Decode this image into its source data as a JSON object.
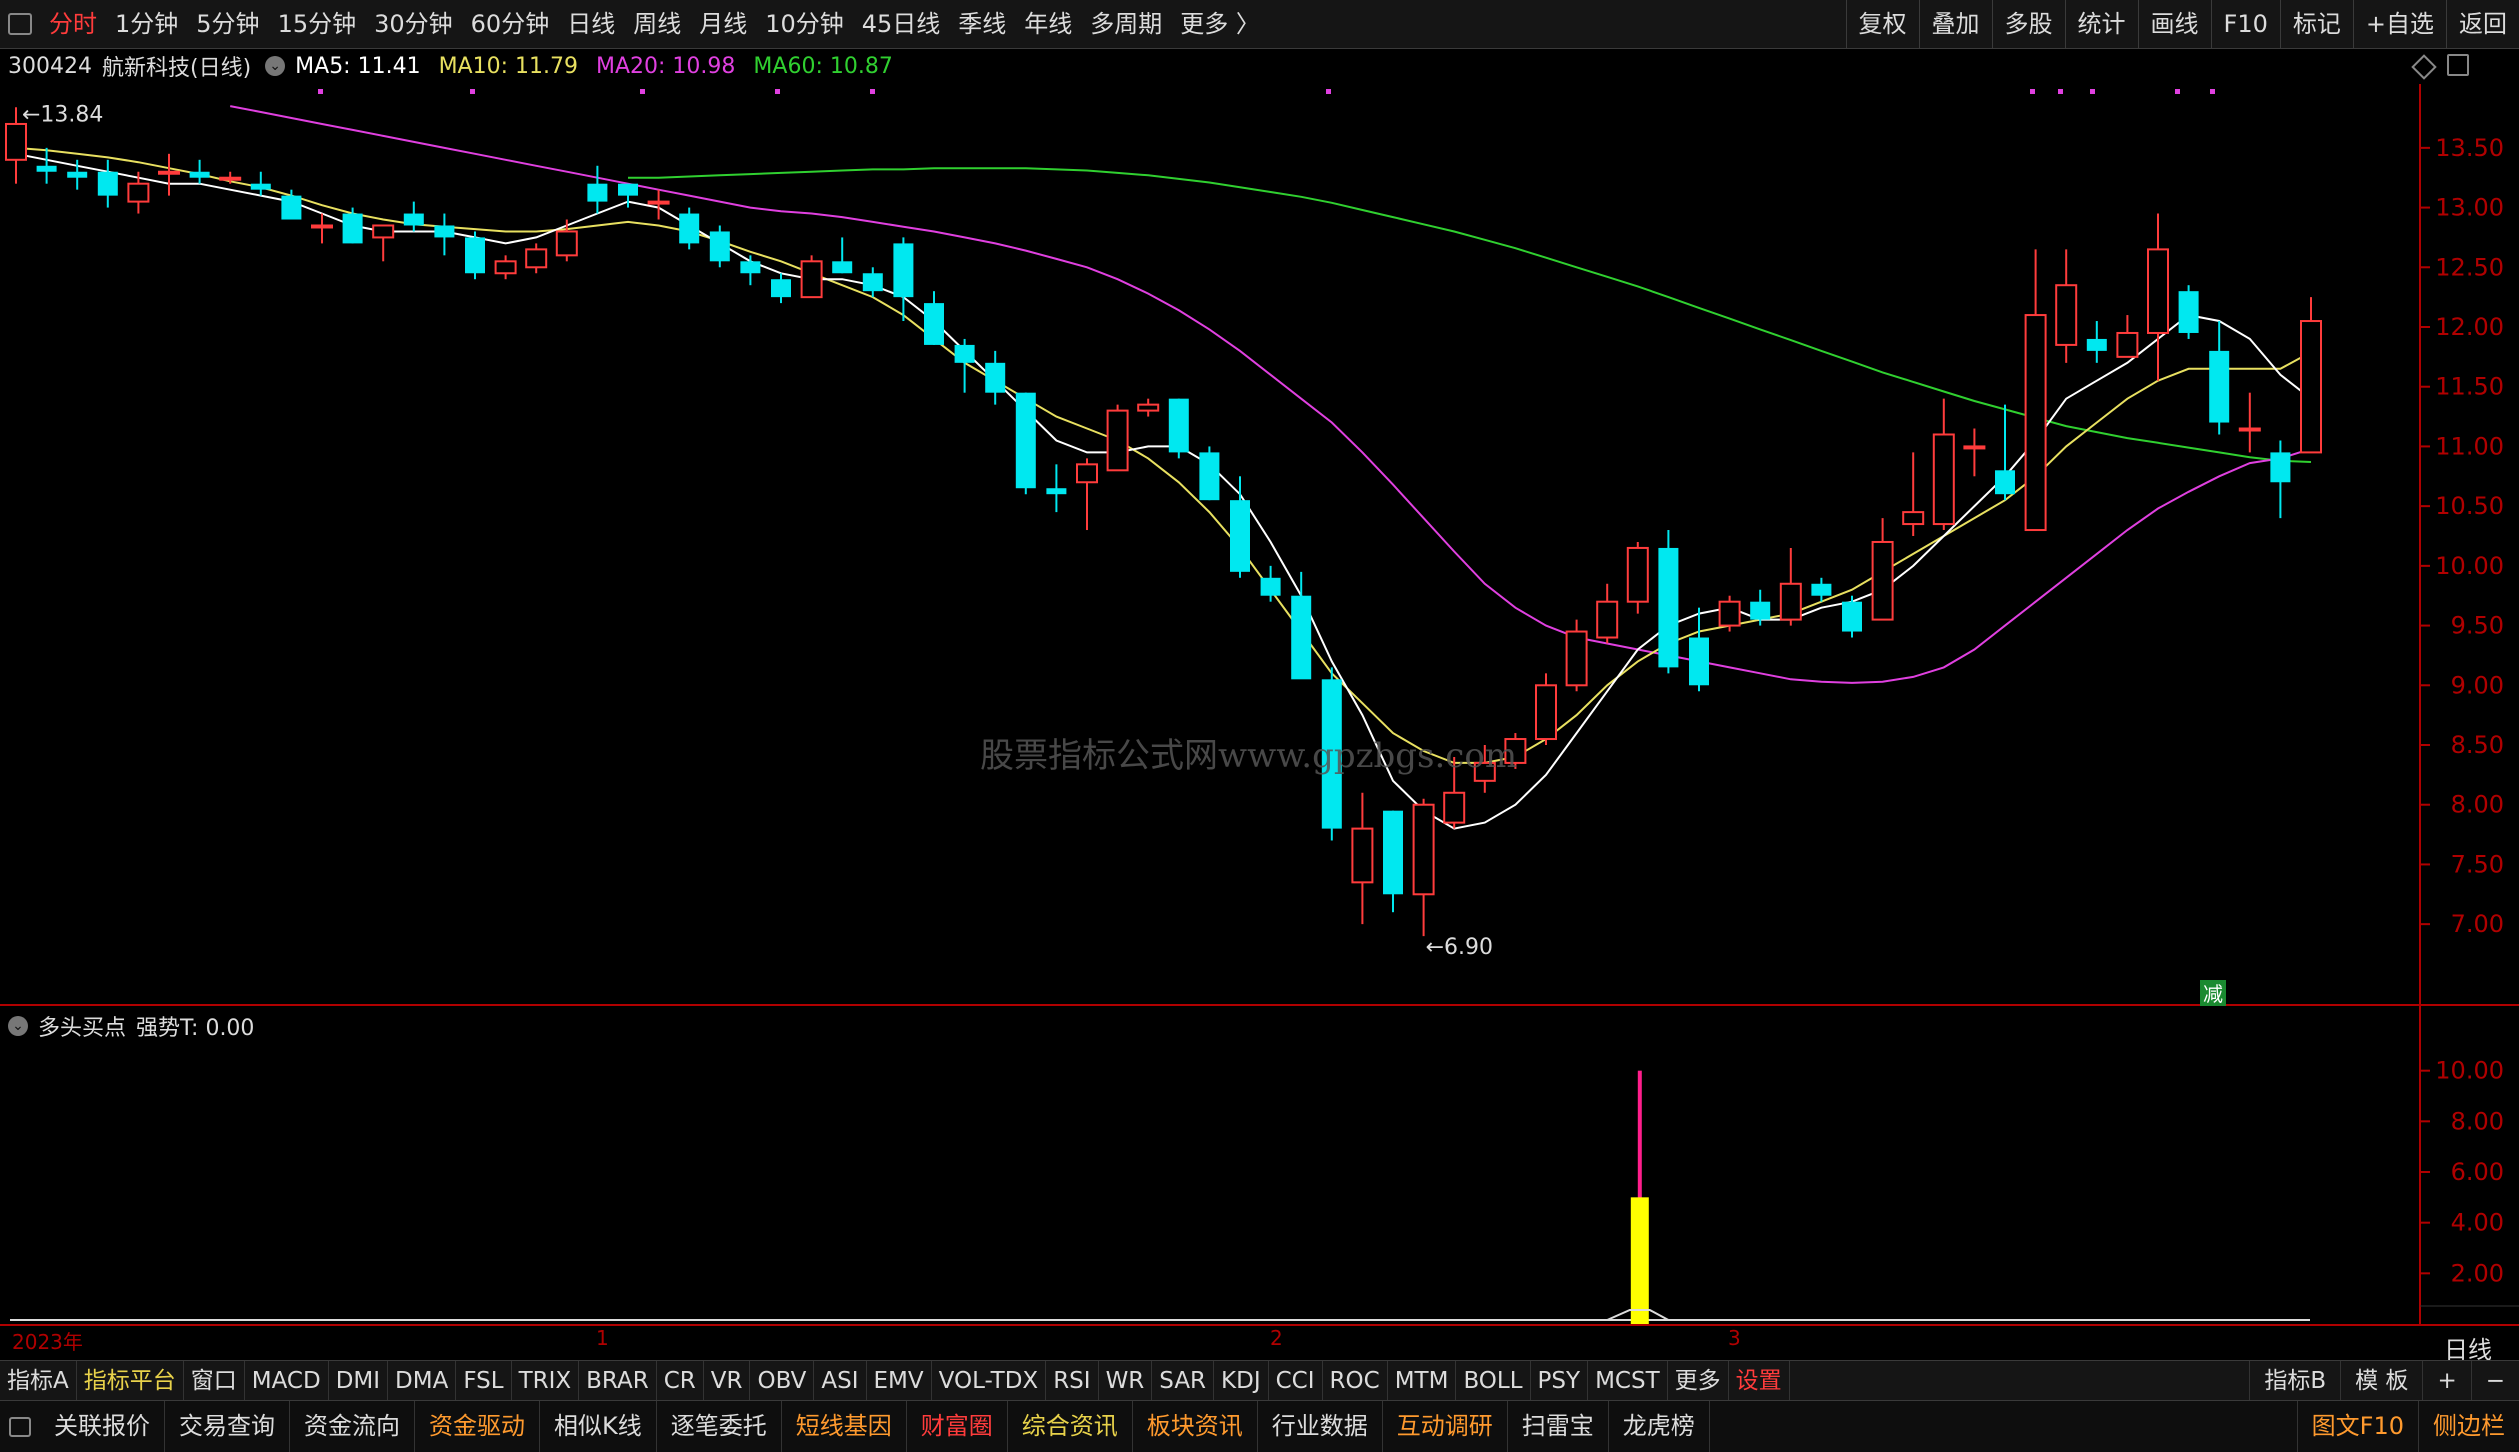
{
  "topbar": {
    "periods": [
      "分时",
      "1分钟",
      "5分钟",
      "15分钟",
      "30分钟",
      "60分钟",
      "日线",
      "周线",
      "月线",
      "10分钟",
      "45日线",
      "季线",
      "年线",
      "多周期",
      "更多 〉"
    ],
    "active_period": "分时",
    "tools": [
      "复权",
      "叠加",
      "多股",
      "统计",
      "画线",
      "F10",
      "标记",
      "+自选",
      "返回"
    ]
  },
  "stock": {
    "code": "300424",
    "name": "航新科技(日线)",
    "ma5_label": "MA5: 11.41",
    "ma10_label": "MA10: 11.79",
    "ma20_label": "MA20: 10.98",
    "ma60_label": "MA60: 10.87"
  },
  "colors": {
    "up": "#ff3c3c",
    "down": "#00e8f0",
    "ma5": "#ffffff",
    "ma10": "#e8e060",
    "ma20": "#e040e0",
    "ma60": "#30d030",
    "axis": "#b00000",
    "bar_magenta": "#ff1e8c",
    "bar_yellow": "#ffff00"
  },
  "chart_data": [
    {
      "type": "candlestick",
      "title": "航新科技(日线)",
      "ylim": [
        6.75,
        13.75
      ],
      "y_ticks": [
        "13.50",
        "13.00",
        "12.50",
        "12.00",
        "11.50",
        "11.00",
        "10.50",
        "10.00",
        "9.50",
        "9.00",
        "8.50",
        "8.00",
        "7.50",
        "7.00"
      ],
      "annotations": {
        "high": "13.84",
        "low": "6.90",
        "marker": "减"
      },
      "candles": [
        {
          "o": 13.4,
          "h": 13.84,
          "l": 13.2,
          "c": 13.7
        },
        {
          "o": 13.35,
          "h": 13.5,
          "l": 13.2,
          "c": 13.3
        },
        {
          "o": 13.3,
          "h": 13.4,
          "l": 13.15,
          "c": 13.25
        },
        {
          "o": 13.3,
          "h": 13.4,
          "l": 13.0,
          "c": 13.1
        },
        {
          "o": 13.05,
          "h": 13.3,
          "l": 12.95,
          "c": 13.2
        },
        {
          "o": 13.3,
          "h": 13.45,
          "l": 13.1,
          "c": 13.3
        },
        {
          "o": 13.3,
          "h": 13.4,
          "l": 13.2,
          "c": 13.25
        },
        {
          "o": 13.25,
          "h": 13.3,
          "l": 13.2,
          "c": 13.25
        },
        {
          "o": 13.2,
          "h": 13.3,
          "l": 13.1,
          "c": 13.15
        },
        {
          "o": 13.1,
          "h": 13.15,
          "l": 12.9,
          "c": 12.9
        },
        {
          "o": 12.85,
          "h": 12.95,
          "l": 12.7,
          "c": 12.85
        },
        {
          "o": 12.95,
          "h": 13.0,
          "l": 12.7,
          "c": 12.7
        },
        {
          "o": 12.75,
          "h": 12.85,
          "l": 12.55,
          "c": 12.85
        },
        {
          "o": 12.95,
          "h": 13.05,
          "l": 12.8,
          "c": 12.85
        },
        {
          "o": 12.85,
          "h": 12.95,
          "l": 12.6,
          "c": 12.75
        },
        {
          "o": 12.75,
          "h": 12.8,
          "l": 12.4,
          "c": 12.45
        },
        {
          "o": 12.45,
          "h": 12.6,
          "l": 12.4,
          "c": 12.55
        },
        {
          "o": 12.5,
          "h": 12.7,
          "l": 12.45,
          "c": 12.65
        },
        {
          "o": 12.6,
          "h": 12.9,
          "l": 12.55,
          "c": 12.8
        },
        {
          "o": 13.2,
          "h": 13.35,
          "l": 12.95,
          "c": 13.05
        },
        {
          "o": 13.2,
          "h": 13.2,
          "l": 13.0,
          "c": 13.1
        },
        {
          "o": 13.05,
          "h": 13.15,
          "l": 12.9,
          "c": 13.05
        },
        {
          "o": 12.95,
          "h": 13.0,
          "l": 12.65,
          "c": 12.7
        },
        {
          "o": 12.8,
          "h": 12.85,
          "l": 12.5,
          "c": 12.55
        },
        {
          "o": 12.55,
          "h": 12.6,
          "l": 12.35,
          "c": 12.45
        },
        {
          "o": 12.4,
          "h": 12.45,
          "l": 12.2,
          "c": 12.25
        },
        {
          "o": 12.25,
          "h": 12.6,
          "l": 12.25,
          "c": 12.55
        },
        {
          "o": 12.55,
          "h": 12.75,
          "l": 12.45,
          "c": 12.45
        },
        {
          "o": 12.45,
          "h": 12.5,
          "l": 12.25,
          "c": 12.3
        },
        {
          "o": 12.7,
          "h": 12.75,
          "l": 12.05,
          "c": 12.25
        },
        {
          "o": 12.2,
          "h": 12.3,
          "l": 11.85,
          "c": 11.85
        },
        {
          "o": 11.85,
          "h": 11.9,
          "l": 11.45,
          "c": 11.7
        },
        {
          "o": 11.7,
          "h": 11.8,
          "l": 11.35,
          "c": 11.45
        },
        {
          "o": 11.45,
          "h": 11.45,
          "l": 10.6,
          "c": 10.65
        },
        {
          "o": 10.65,
          "h": 10.85,
          "l": 10.45,
          "c": 10.6
        },
        {
          "o": 10.7,
          "h": 10.9,
          "l": 10.3,
          "c": 10.85
        },
        {
          "o": 10.8,
          "h": 11.35,
          "l": 10.8,
          "c": 11.3
        },
        {
          "o": 11.3,
          "h": 11.4,
          "l": 11.25,
          "c": 11.35
        },
        {
          "o": 11.4,
          "h": 11.4,
          "l": 10.9,
          "c": 10.95
        },
        {
          "o": 10.95,
          "h": 11.0,
          "l": 10.55,
          "c": 10.55
        },
        {
          "o": 10.55,
          "h": 10.75,
          "l": 9.9,
          "c": 9.95
        },
        {
          "o": 9.9,
          "h": 10.0,
          "l": 9.7,
          "c": 9.75
        },
        {
          "o": 9.75,
          "h": 9.95,
          "l": 9.1,
          "c": 9.05
        },
        {
          "o": 9.05,
          "h": 9.15,
          "l": 7.7,
          "c": 7.8
        },
        {
          "o": 7.35,
          "h": 8.1,
          "l": 7.0,
          "c": 7.8
        },
        {
          "o": 7.95,
          "h": 7.95,
          "l": 7.1,
          "c": 7.25
        },
        {
          "o": 7.25,
          "h": 8.05,
          "l": 6.9,
          "c": 8.0
        },
        {
          "o": 7.85,
          "h": 8.4,
          "l": 7.8,
          "c": 8.1
        },
        {
          "o": 8.2,
          "h": 8.5,
          "l": 8.1,
          "c": 8.35
        },
        {
          "o": 8.35,
          "h": 8.6,
          "l": 8.3,
          "c": 8.55
        },
        {
          "o": 8.55,
          "h": 9.1,
          "l": 8.5,
          "c": 9.0
        },
        {
          "o": 9.0,
          "h": 9.55,
          "l": 8.95,
          "c": 9.45
        },
        {
          "o": 9.4,
          "h": 9.85,
          "l": 9.35,
          "c": 9.7
        },
        {
          "o": 9.7,
          "h": 10.2,
          "l": 9.6,
          "c": 10.15
        },
        {
          "o": 10.15,
          "h": 10.3,
          "l": 9.1,
          "c": 9.15
        },
        {
          "o": 9.4,
          "h": 9.65,
          "l": 8.95,
          "c": 9.0
        },
        {
          "o": 9.5,
          "h": 9.75,
          "l": 9.45,
          "c": 9.7
        },
        {
          "o": 9.7,
          "h": 9.8,
          "l": 9.5,
          "c": 9.55
        },
        {
          "o": 9.55,
          "h": 10.15,
          "l": 9.5,
          "c": 9.85
        },
        {
          "o": 9.85,
          "h": 9.9,
          "l": 9.7,
          "c": 9.75
        },
        {
          "o": 9.7,
          "h": 9.75,
          "l": 9.4,
          "c": 9.45
        },
        {
          "o": 9.55,
          "h": 10.4,
          "l": 9.55,
          "c": 10.2
        },
        {
          "o": 10.35,
          "h": 10.95,
          "l": 10.25,
          "c": 10.45
        },
        {
          "o": 10.35,
          "h": 11.4,
          "l": 10.3,
          "c": 11.1
        },
        {
          "o": 11.0,
          "h": 11.15,
          "l": 10.75,
          "c": 11.0
        },
        {
          "o": 10.8,
          "h": 11.35,
          "l": 10.55,
          "c": 10.6
        },
        {
          "o": 10.3,
          "h": 12.65,
          "l": 10.3,
          "c": 12.1
        },
        {
          "o": 11.85,
          "h": 12.65,
          "l": 11.7,
          "c": 12.35
        },
        {
          "o": 11.9,
          "h": 12.05,
          "l": 11.7,
          "c": 11.8
        },
        {
          "o": 11.75,
          "h": 12.1,
          "l": 11.75,
          "c": 11.95
        },
        {
          "o": 11.95,
          "h": 12.95,
          "l": 11.55,
          "c": 12.65
        },
        {
          "o": 12.3,
          "h": 12.35,
          "l": 11.9,
          "c": 11.95
        },
        {
          "o": 11.8,
          "h": 12.05,
          "l": 11.1,
          "c": 11.2
        },
        {
          "o": 11.15,
          "h": 11.45,
          "l": 10.95,
          "c": 11.15
        },
        {
          "o": 10.95,
          "h": 11.05,
          "l": 10.4,
          "c": 10.7
        },
        {
          "o": 10.95,
          "h": 12.25,
          "l": 10.95,
          "c": 12.05
        }
      ],
      "ma5": [
        13.45,
        13.4,
        13.35,
        13.3,
        13.25,
        13.2,
        13.2,
        13.15,
        13.1,
        13.05,
        12.95,
        12.85,
        12.8,
        12.8,
        12.8,
        12.75,
        12.7,
        12.75,
        12.85,
        12.95,
        13.05,
        13.0,
        12.85,
        12.7,
        12.55,
        12.45,
        12.4,
        12.4,
        12.35,
        12.25,
        12.05,
        11.8,
        11.55,
        11.3,
        11.05,
        10.95,
        10.95,
        11.0,
        11.0,
        10.85,
        10.6,
        10.2,
        9.75,
        9.2,
        8.75,
        8.2,
        7.95,
        7.8,
        7.85,
        8.0,
        8.25,
        8.6,
        8.95,
        9.3,
        9.5,
        9.6,
        9.65,
        9.55,
        9.55,
        9.65,
        9.7,
        9.8,
        10.0,
        10.25,
        10.5,
        10.75,
        11.05,
        11.4,
        11.55,
        11.7,
        11.9,
        12.1,
        12.05,
        11.9,
        11.6,
        11.4
      ],
      "ma10": [
        13.5,
        13.48,
        13.45,
        13.42,
        13.38,
        13.33,
        13.28,
        13.22,
        13.17,
        13.1,
        13.02,
        12.95,
        12.9,
        12.86,
        12.84,
        12.82,
        12.8,
        12.8,
        12.82,
        12.85,
        12.88,
        12.85,
        12.8,
        12.72,
        12.63,
        12.55,
        12.45,
        12.35,
        12.25,
        12.1,
        11.9,
        11.7,
        11.55,
        11.4,
        11.25,
        11.15,
        11.05,
        10.9,
        10.7,
        10.45,
        10.15,
        9.8,
        9.45,
        9.1,
        8.85,
        8.6,
        8.45,
        8.35,
        8.35,
        8.4,
        8.55,
        8.75,
        9.0,
        9.2,
        9.35,
        9.45,
        9.5,
        9.55,
        9.6,
        9.7,
        9.8,
        9.95,
        10.1,
        10.25,
        10.4,
        10.55,
        10.75,
        11.0,
        11.2,
        11.4,
        11.55,
        11.65,
        11.65,
        11.65,
        11.65,
        11.79
      ],
      "ma20": [
        13.85,
        13.8,
        13.75,
        13.7,
        13.65,
        13.6,
        13.55,
        13.5,
        13.45,
        13.4,
        13.35,
        13.3,
        13.25,
        13.2,
        13.15,
        13.1,
        13.05,
        13.0,
        12.97,
        12.95,
        12.92,
        12.88,
        12.84,
        12.8,
        12.75,
        12.7,
        12.64,
        12.57,
        12.5,
        12.4,
        12.28,
        12.14,
        11.98,
        11.8,
        11.6,
        11.4,
        11.2,
        10.95,
        10.68,
        10.4,
        10.12,
        9.85,
        9.65,
        9.5,
        9.4,
        9.35,
        9.3,
        9.25,
        9.2,
        9.15,
        9.1,
        9.05,
        9.03,
        9.02,
        9.03,
        9.07,
        9.15,
        9.3,
        9.5,
        9.7,
        9.9,
        10.1,
        10.3,
        10.48,
        10.62,
        10.75,
        10.86,
        10.9,
        10.98
      ],
      "ma60": [
        13.25,
        13.25,
        13.26,
        13.27,
        13.28,
        13.29,
        13.3,
        13.31,
        13.32,
        13.32,
        13.33,
        13.33,
        13.33,
        13.33,
        13.32,
        13.31,
        13.29,
        13.27,
        13.24,
        13.21,
        13.17,
        13.13,
        13.09,
        13.04,
        12.98,
        12.92,
        12.86,
        12.8,
        12.73,
        12.66,
        12.58,
        12.5,
        12.42,
        12.34,
        12.25,
        12.16,
        12.07,
        11.98,
        11.89,
        11.8,
        11.71,
        11.62,
        11.54,
        11.46,
        11.38,
        11.31,
        11.24,
        11.17,
        11.12,
        11.07,
        11.03,
        10.99,
        10.95,
        10.91,
        10.88,
        10.87
      ]
    },
    {
      "type": "bar",
      "title": "多头买点 强势T: 0.00",
      "ylim": [
        0,
        10.5
      ],
      "y_ticks": [
        "10.00",
        "8.00",
        "6.00",
        "4.00",
        "2.00"
      ],
      "bars": [
        {
          "candle_index": 53,
          "value": 10.0,
          "color": "magenta"
        },
        {
          "candle_index": 53,
          "value": 5.0,
          "color": "yellow"
        }
      ]
    }
  ],
  "indicator_header": {
    "label": "多头买点",
    "value": "强势T: 0.00"
  },
  "dates": {
    "year": "2023年",
    "m1": "1",
    "m2": "2",
    "m3": "3",
    "period_label": "日线"
  },
  "indicator_tabs": [
    "指标A",
    "指标平台",
    "窗口",
    "MACD",
    "DMI",
    "DMA",
    "FSL",
    "TRIX",
    "BRAR",
    "CR",
    "VR",
    "OBV",
    "ASI",
    "EMV",
    "VOL-TDX",
    "RSI",
    "WR",
    "SAR",
    "KDJ",
    "CCI",
    "ROC",
    "MTM",
    "BOLL",
    "PSY",
    "MCST",
    "更多",
    "设置"
  ],
  "indicator_tabs_right": [
    "指标B",
    "模 板",
    "+",
    "−"
  ],
  "func_bar": [
    {
      "label": "关联报价",
      "color": "white"
    },
    {
      "label": "交易查询",
      "color": "white"
    },
    {
      "label": "资金流向",
      "color": "white"
    },
    {
      "label": "资金驱动",
      "color": "orange"
    },
    {
      "label": "相似K线",
      "color": "white"
    },
    {
      "label": "逐笔委托",
      "color": "white"
    },
    {
      "label": "短线基因",
      "color": "orange"
    },
    {
      "label": "财富圈",
      "color": "red"
    },
    {
      "label": "综合资讯",
      "color": "yellow"
    },
    {
      "label": "板块资讯",
      "color": "orange"
    },
    {
      "label": "行业数据",
      "color": "white"
    },
    {
      "label": "互动调研",
      "color": "orange"
    },
    {
      "label": "扫雷宝",
      "color": "white"
    },
    {
      "label": "龙虎榜",
      "color": "white"
    }
  ],
  "func_bar_right": [
    {
      "label": "图文F10",
      "color": "orange"
    },
    {
      "label": "侧边栏",
      "color": "orange"
    }
  ],
  "watermark": "股票指标公式网www.gpzbgs.com"
}
